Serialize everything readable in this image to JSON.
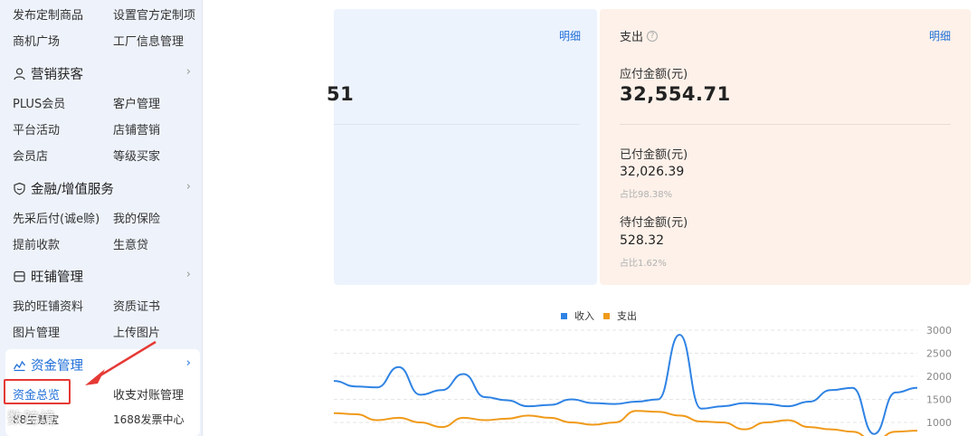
{
  "sidebar": {
    "rows": [
      {
        "left": "发布定制商品",
        "right": "设置官方定制项"
      },
      {
        "left": "商机广场",
        "right": "工厂信息管理"
      }
    ],
    "sections": [
      {
        "title": "营销获客",
        "icon": "user-icon",
        "rows": [
          [
            "PLUS会员",
            "客户管理"
          ],
          [
            "平台活动",
            "店铺营销"
          ],
          [
            "会员店",
            "等级买家"
          ]
        ]
      },
      {
        "title": "金融/增值服务",
        "icon": "shield-icon",
        "rows": [
          [
            "先采后付(诚e赊)",
            "我的保险"
          ],
          [
            "提前收款",
            "生意贷"
          ]
        ]
      },
      {
        "title": "旺铺管理",
        "icon": "store-icon",
        "rows": [
          [
            "我的旺铺资料",
            "资质证书"
          ],
          [
            "图片管理",
            "上传图片"
          ]
        ]
      },
      {
        "title": "资金管理",
        "icon": "chart-icon",
        "rows": [
          [
            "资金总览",
            "收支对账管理"
          ],
          [
            "88生意宝",
            "1688发票中心"
          ]
        ]
      }
    ],
    "chevron": "›"
  },
  "watermark": "数跨境",
  "income_card": {
    "detail_label": "明细",
    "amount_fragment": "51"
  },
  "expense_card": {
    "title": "支出",
    "help_icon": "?",
    "detail_label": "明细",
    "payable_label": "应付金额(元)",
    "payable_value": "32,554.71",
    "paid_label": "已付金额(元)",
    "paid_value": "32,026.39",
    "paid_ratio": "占比98.38%",
    "pending_label": "待付金额(元)",
    "pending_value": "528.32",
    "pending_ratio": "占比1.62%"
  },
  "chart_data": {
    "type": "line",
    "legend": [
      "收入",
      "支出"
    ],
    "legend_position": "top",
    "y_ticks": [
      "3000",
      "2500",
      "2000",
      "1500",
      "1000"
    ],
    "ylim": [
      500,
      3000
    ],
    "grid": true,
    "colors": {
      "income": "#2f83e4",
      "expense": "#f09a1a"
    },
    "series": [
      {
        "name": "收入",
        "values": [
          1900,
          1780,
          1760,
          2200,
          1600,
          1700,
          2050,
          1550,
          1480,
          1350,
          1380,
          1500,
          1420,
          1400,
          1450,
          1500,
          2900,
          1300,
          1350,
          1420,
          1400,
          1350,
          1450,
          1700,
          1750,
          750,
          1650,
          1750
        ]
      },
      {
        "name": "支出",
        "values": [
          1200,
          1180,
          1050,
          1100,
          1000,
          900,
          1100,
          1050,
          1080,
          1150,
          1100,
          1000,
          950,
          1000,
          1250,
          1230,
          1150,
          1020,
          1000,
          850,
          1000,
          1050,
          900,
          850,
          800,
          600,
          800,
          820
        ]
      }
    ]
  }
}
